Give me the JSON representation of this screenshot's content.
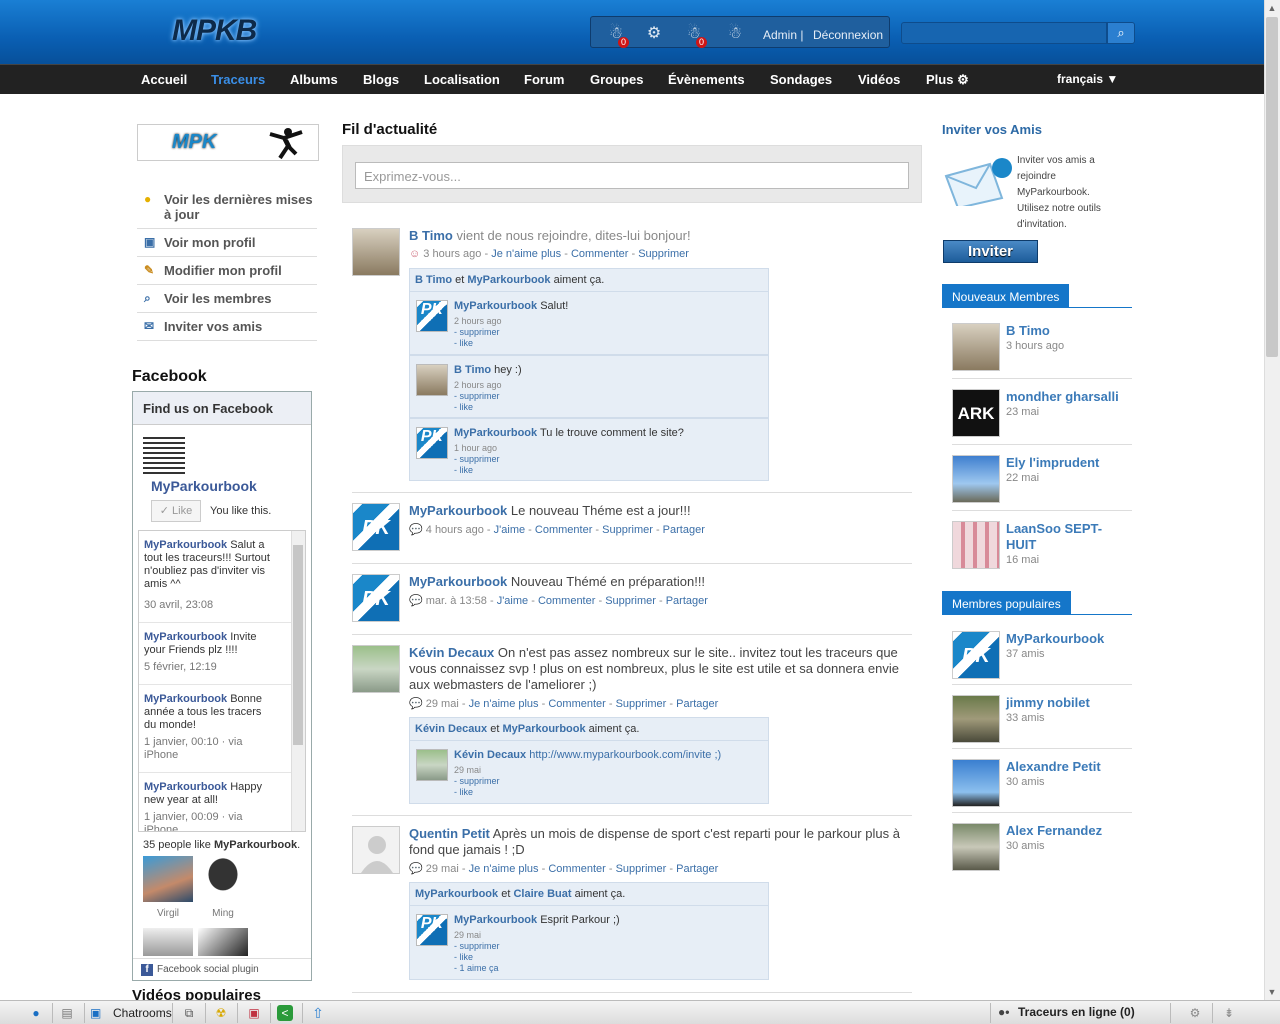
{
  "header": {
    "logo_text": "MPKB",
    "notif_count_1": "0",
    "notif_count_2": "0",
    "admin_label": "Admin |",
    "logout_label": "Déconnexion",
    "search_value": ""
  },
  "nav": {
    "items": [
      "Accueil",
      "Traceurs",
      "Albums",
      "Blogs",
      "Localisation",
      "Forum",
      "Groupes",
      "Évènements",
      "Sondages",
      "Vidéos",
      "Plus ⚙"
    ],
    "active": "Traceurs",
    "language": "français ▼"
  },
  "left": {
    "logo_text": "MPK",
    "menu": [
      {
        "label": "Voir les dernières mises à jour",
        "icon": "lightbulb-icon",
        "glyph": "💡"
      },
      {
        "label": "Voir mon profil",
        "icon": "profile-icon",
        "glyph": "▣"
      },
      {
        "label": "Modifier mon profil",
        "icon": "pencil-icon",
        "glyph": "✎"
      },
      {
        "label": "Voir les membres",
        "icon": "magnifier-icon",
        "glyph": "🔍"
      },
      {
        "label": "Inviter vos amis",
        "icon": "envelope-icon",
        "glyph": "✉"
      }
    ],
    "facebook_title": "Facebook",
    "fb_box_title": "Find us on Facebook",
    "fb_page_name": "MyParkourbook",
    "fb_like_label": "Like",
    "fb_you_like": "You like this.",
    "fb_posts": [
      {
        "author": "MyParkourbook",
        "text": "Salut a tout les traceurs!!! Surtout n'oubliez pas d'inviter vis amis ^^",
        "date": "30 avril, 23:08"
      },
      {
        "author": "MyParkourbook",
        "text": "Invite your Friends plz !!!!",
        "date": "5 février, 12:19"
      },
      {
        "author": "MyParkourbook",
        "text": "Bonne année a tous les tracers du monde!",
        "date": "1 janvier, 00:10 · via iPhone"
      },
      {
        "author": "MyParkourbook",
        "text": "Happy new year at all!",
        "date": "1 janvier, 00:09 · via iPhone"
      }
    ],
    "fb_likes_count_text": "35 people like",
    "fb_likes_page": "MyParkourbook",
    "fb_fans": [
      "Virgil",
      "Ming"
    ],
    "fb_plugin_label": "Facebook social plugin",
    "videos_title": "Vidéos populaires"
  },
  "feed": {
    "title": "Fil d'actualité",
    "status_placeholder": "Exprimez-vous...",
    "posts": [
      {
        "author": "B Timo",
        "text": "vient de nous rejoindre, dites-lui bonjour!",
        "meta_time": "3 hours ago",
        "meta_actions": [
          "Je n'aime plus",
          "Commenter",
          "Supprimer"
        ],
        "likes_a": "B Timo",
        "likes_mid": "et",
        "likes_b": "MyParkourbook",
        "likes_end": "aiment ça.",
        "comments": [
          {
            "author": "MyParkourbook",
            "text": "Salut!",
            "time": "2 hours ago",
            "actions": [
              "- supprimer",
              "- like"
            ]
          },
          {
            "author": "B Timo",
            "text": "hey :)",
            "time": "2 hours ago",
            "actions": [
              "- supprimer",
              "- like"
            ]
          },
          {
            "author": "MyParkourbook",
            "text": "Tu le trouve comment le site?",
            "time": "1 hour ago",
            "actions": [
              "- supprimer",
              "- like"
            ]
          }
        ]
      },
      {
        "author": "MyParkourbook",
        "text": "Le nouveau Théme est a jour!!!",
        "meta_time": "4 hours ago",
        "meta_actions": [
          "J'aime",
          "Commenter",
          "Supprimer",
          "Partager"
        ]
      },
      {
        "author": "MyParkourbook",
        "text": "Nouveau Thémé en préparation!!!",
        "meta_time": "mar. à 13:58",
        "meta_actions": [
          "J'aime",
          "Commenter",
          "Supprimer",
          "Partager"
        ]
      },
      {
        "author": "Kévin Decaux",
        "text": "On n'est pas assez nombreux sur le site.. invitez tout les traceurs que vous connaissez svp !  plus on est nombreux, plus le site est utile et sa donnera envie aux webmasters de l'ameliorer ;)",
        "meta_time": "29 mai",
        "meta_actions": [
          "Je n'aime plus",
          "Commenter",
          "Supprimer",
          "Partager"
        ],
        "likes_a": "Kévin Decaux",
        "likes_mid": "et",
        "likes_b": "MyParkourbook",
        "likes_end": "aiment ça.",
        "comments": [
          {
            "author": "Kévin Decaux",
            "text": "http://www.myparkourbook.com/invite ;)",
            "time": "29 mai",
            "actions": [
              "- supprimer",
              "- like"
            ]
          }
        ]
      },
      {
        "author": "Quentin Petit",
        "text": "Après un mois de dispense de sport c'est reparti pour le parkour plus à fond que jamais ! ;D",
        "meta_time": "29 mai",
        "meta_actions": [
          "Je n'aime plus",
          "Commenter",
          "Supprimer",
          "Partager"
        ],
        "likes_a": "MyParkourbook",
        "likes_mid": "et",
        "likes_b": "Claire Buat",
        "likes_end": "aiment ça.",
        "comments": [
          {
            "author": "MyParkourbook",
            "text": "Esprit Parkour ;)",
            "time": "29 mai",
            "actions": [
              "- supprimer",
              "- like",
              "- 1 aime ça"
            ]
          }
        ]
      }
    ]
  },
  "right": {
    "invite_title": "Inviter vos Amis",
    "invite_text": "Inviter vos amis a rejoindre MyParkourbook. Utilisez notre outils d'invitation.",
    "invite_button": "Inviter",
    "new_members_title": "Nouveaux Membres",
    "new_members": [
      {
        "name": "B Timo",
        "sub": "3 hours ago"
      },
      {
        "name": "mondher gharsalli",
        "sub": "23 mai"
      },
      {
        "name": "Ely l'imprudent",
        "sub": "22 mai"
      },
      {
        "name": "LaanSoo SEPT-HUIT",
        "sub": "16 mai"
      }
    ],
    "popular_title": "Membres populaires",
    "popular": [
      {
        "name": "MyParkourbook",
        "sub": "37 amis"
      },
      {
        "name": "jimmy nobilet",
        "sub": "33 amis"
      },
      {
        "name": "Alexandre Petit",
        "sub": "30 amis"
      },
      {
        "name": "Alex Fernandez",
        "sub": "30 amis"
      }
    ]
  },
  "taskbar": {
    "chatrooms": "Chatrooms",
    "online": "Traceurs en ligne (0)"
  },
  "colors": {
    "brand_blue": "#1576c9",
    "nav_bg": "#222222",
    "link": "#3b6fa8"
  }
}
